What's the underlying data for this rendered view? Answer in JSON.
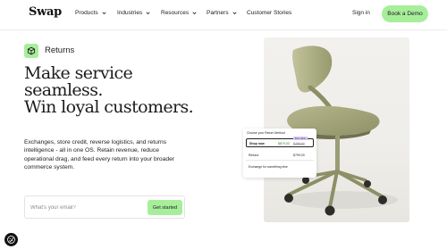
{
  "nav": {
    "logo": "Swap",
    "links": [
      {
        "label": "Products",
        "has_dropdown": true
      },
      {
        "label": "Industries",
        "has_dropdown": true
      },
      {
        "label": "Resources",
        "has_dropdown": true
      },
      {
        "label": "Partners",
        "has_dropdown": true
      },
      {
        "label": "Customer Stories",
        "has_dropdown": false
      }
    ],
    "signin_label": "Sign in",
    "demo_label": "Book a Demo"
  },
  "hero": {
    "badge_label": "Returns",
    "badge_icon": "box-icon",
    "headline": [
      "Make service",
      "seamless.",
      "Win loyal customers."
    ],
    "description": "Exchanges, store credit, reverse logistics, and returns intelligence - all in one OS. Retain revenue, reduce operational drag, and feed every return into your broader commerce system.",
    "email_placeholder": "What's your email?",
    "cta_label": "Get started"
  },
  "return_card": {
    "title": "Choose your Return Method",
    "options": [
      {
        "label": "Shop now",
        "price": "$879.00",
        "old_price": "$799.00",
        "tag": "Best Value",
        "selected": true
      },
      {
        "label": "Refund",
        "price": "$799.00"
      },
      {
        "label": "Exchange for something else"
      }
    ]
  },
  "colors": {
    "accent": "#a7ee9b",
    "text": "#1c1c1c",
    "tag_bg": "#d7c8f3",
    "chair": "#a2a47a"
  },
  "cookie_icon": "cookie-settings-icon"
}
